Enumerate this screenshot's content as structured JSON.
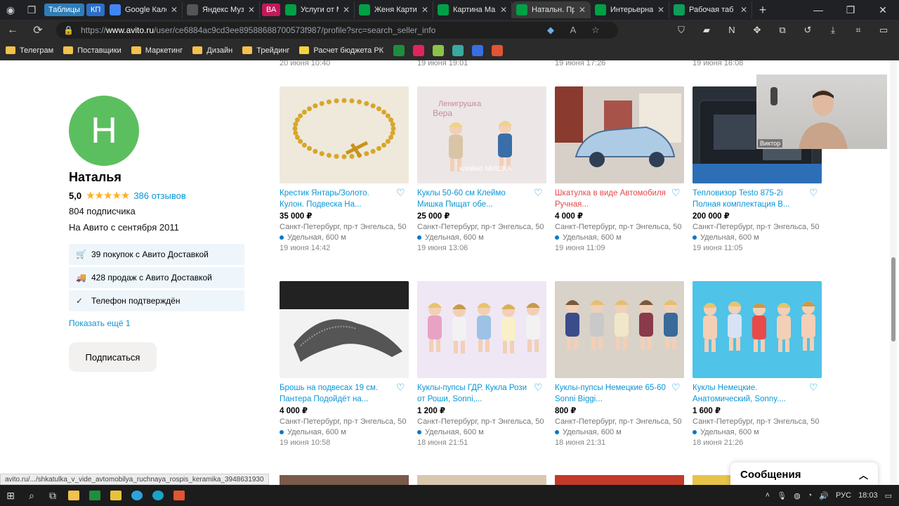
{
  "browser": {
    "tabs": [
      {
        "label": "Таблицы",
        "kind": "pill",
        "color": "#2e7db9"
      },
      {
        "label": "КП",
        "kind": "pill",
        "color": "#2a6fc9"
      },
      {
        "label": "Google Кален",
        "color": "#4285f4"
      },
      {
        "label": "Яндекс Музы",
        "color": "#555555"
      },
      {
        "label": "ВА",
        "kind": "pill",
        "color": "#c2185b"
      },
      {
        "label": "Услуги от М",
        "color": "#00a046"
      },
      {
        "label": "Женя Картин",
        "color": "#00a046"
      },
      {
        "label": "Картина Ма",
        "color": "#00a046"
      },
      {
        "label": "Натальн. Пр",
        "color": "#00a046",
        "active": true
      },
      {
        "label": "Интерьерна",
        "color": "#00a046"
      },
      {
        "label": "Рабочая таб",
        "color": "#0f9d58"
      }
    ],
    "url_prefix": "https://",
    "url_host": "www.avito.ru",
    "url_path": "/user/ce6884ac9cd3ee89588688700573f987/profile?src=search_seller_info",
    "bookmarks": [
      "Телеграм",
      "Поставщики",
      "Маркетинг",
      "Дизайн",
      "Трейдинг",
      "Расчет бюджета РК"
    ]
  },
  "profile": {
    "initial": "Н",
    "name": "Наталья",
    "rating": "5,0",
    "stars": "★★★★★",
    "reviews": "386 отзывов",
    "subscribers": "804 подписчика",
    "since": "На Авито с сентября 2011",
    "badges": [
      "39 покупок с Авито Доставкой",
      "428 продаж с Авито Доставкой",
      "Телефон подтверждён"
    ],
    "show_more": "Показать ещё 1",
    "subscribe": "Подписаться"
  },
  "top_dates": [
    "20 июня 10:40",
    "19 июня 19:01",
    "19 июня 17:26",
    "19 июня 16:08"
  ],
  "listings": [
    {
      "title": "Крестик Янтарь/Золото. Кулон. Подвеска На...",
      "price": "35 000 ₽",
      "address": "Санкт-Петербург, пр-т Энгельса, 50",
      "metro": "Удельная, 600 м",
      "date": "19 июня 14:42",
      "img": "amber"
    },
    {
      "title": "Куклы 50-60 см Клеймо Мишка Пищат обе...",
      "price": "25 000 ₽",
      "address": "Санкт-Петербург, пр-т Энгельса, 50",
      "metro": "Удельная, 600 м",
      "date": "19 июня 13:06",
      "img": "dolls1"
    },
    {
      "title": "Шкатулка в виде Автомобиля Ручная...",
      "price": "4 000 ₽",
      "address": "Санкт-Петербург, пр-т Энгельса, 50",
      "metro": "Удельная, 600 м",
      "date": "19 июня 11:09",
      "img": "car",
      "hover": true
    },
    {
      "title": "Тепловизор Testo 875-2i Полная комплектация В...",
      "price": "200 000 ₽",
      "address": "Санкт-Петербург, пр-т Энгельса, 50",
      "metro": "Удельная, 600 м",
      "date": "19 июня 11:05",
      "img": "case"
    },
    {
      "title": "Брошь на подвесах 19 см. Пантера Подойдёт на...",
      "price": "4 000 ₽",
      "address": "Санкт-Петербург, пр-т Энгельса, 50",
      "metro": "Удельная, 600 м",
      "date": "19 июня 10:58",
      "img": "panther"
    },
    {
      "title": "Куклы-пупсы ГДР. Кукла Рози от Роши, Sonni,...",
      "price": "1 200 ₽",
      "address": "Санкт-Петербург, пр-т Энгельса, 50",
      "metro": "Удельная, 600 м",
      "date": "18 июня 21:51",
      "img": "dolls2"
    },
    {
      "title": "Куклы-пупсы Немецкие 65-60 Sonni Biggi...",
      "price": "800 ₽",
      "address": "Санкт-Петербург, пр-т Энгельса, 50",
      "metro": "Удельная, 600 м",
      "date": "18 июня 21:31",
      "img": "dolls3"
    },
    {
      "title": "Куклы Немецкие. Анатомический, Sonny....",
      "price": "1 600 ₽",
      "address": "Санкт-Петербург, пр-т Энгельса, 50",
      "metro": "Удельная, 600 м",
      "date": "18 июня 21:26",
      "img": "dolls4"
    }
  ],
  "webcam_name": "Виктор",
  "messages": "Сообщения",
  "status_url": "avito.ru/.../shkatulka_v_vide_avtomobilya_ruchnaya_rospis_keramika_3948631930",
  "taskbar": {
    "lang": "РУС",
    "time": "18:03"
  }
}
